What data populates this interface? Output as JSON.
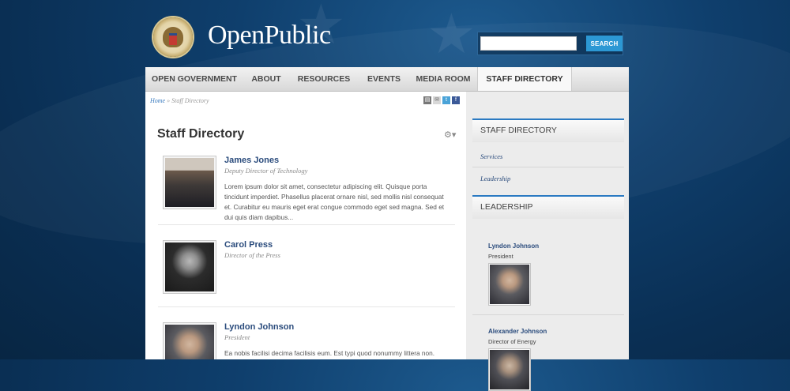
{
  "header": {
    "site_title": "OpenPublic",
    "search": {
      "value": "",
      "button_label": "SEARCH"
    }
  },
  "nav": {
    "items": [
      {
        "label": "OPEN GOVERNMENT"
      },
      {
        "label": "ABOUT"
      },
      {
        "label": "RESOURCES"
      },
      {
        "label": "EVENTS"
      },
      {
        "label": "MEDIA ROOM"
      },
      {
        "label": "STAFF DIRECTORY",
        "active": true
      }
    ]
  },
  "breadcrumb": {
    "home": "Home",
    "separator": "»",
    "current": "Staff Directory"
  },
  "share_icons": [
    "print-icon",
    "email-icon",
    "twitter-icon",
    "facebook-icon"
  ],
  "page": {
    "title": "Staff Directory"
  },
  "staff": [
    {
      "name": "James Jones",
      "title": "Deputy Director of Technology",
      "bio": "Lorem ipsum dolor sit amet, consectetur adipiscing elit. Quisque porta tincidunt imperdiet. Phasellus placerat ornare nisl, sed mollis nisl consequat et. Curabitur eu mauris eget erat congue commodo eget sed magna. Sed et dui quis diam dapibus..."
    },
    {
      "name": "Carol Press",
      "title": "Director of the Press",
      "bio": ""
    },
    {
      "name": "Lyndon Johnson",
      "title": "President",
      "bio": "Ea nobis facilisi decima facilisis eum. Est typi quod nonummy littera non."
    }
  ],
  "sidebar": {
    "staff_directory_heading": "STAFF DIRECTORY",
    "links": [
      "Services",
      "Leadership"
    ],
    "leadership_heading": "LEADERSHIP",
    "leaders": [
      {
        "name": "Lyndon Johnson",
        "role": "President"
      },
      {
        "name": "Alexander Johnson",
        "role": "Director of Energy"
      }
    ]
  },
  "colors": {
    "accent": "#2c98d4",
    "link": "#2a4b7c",
    "background": "#0f3f6d"
  }
}
